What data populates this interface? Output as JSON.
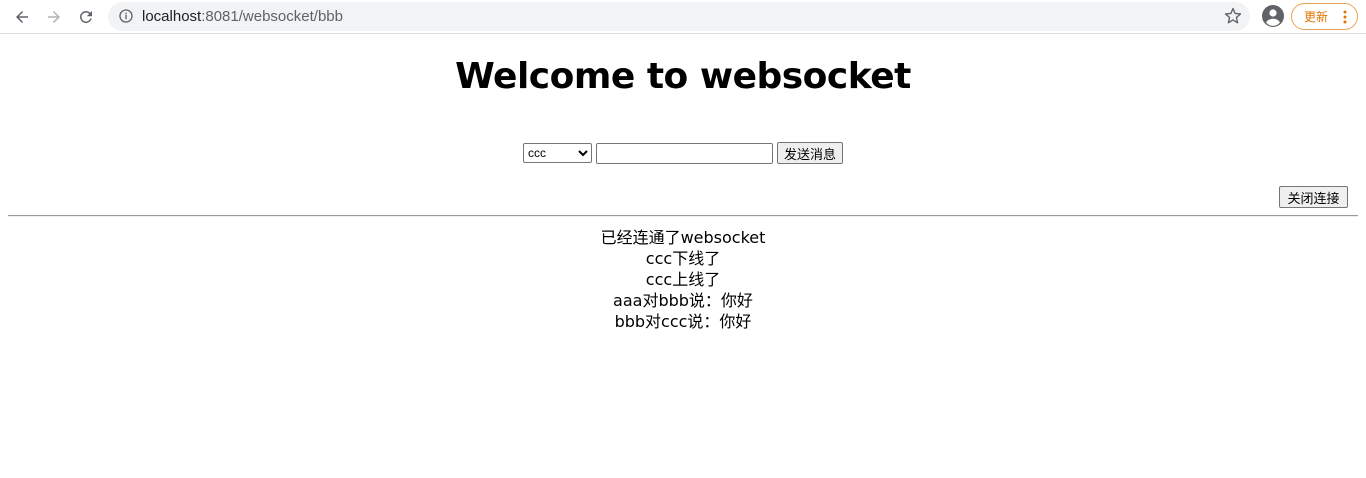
{
  "browser": {
    "url_host": "localhost",
    "url_path": ":8081/websocket/bbb",
    "update_label": "更新",
    "icons": {
      "back": "back-arrow-icon",
      "forward": "forward-arrow-icon",
      "reload": "reload-icon",
      "info": "info-icon",
      "bookmark": "star-icon",
      "profile": "profile-icon",
      "menu": "more-vert-icon"
    },
    "colors": {
      "update_accent": "#e37400",
      "omnibox_bg": "#f1f3f4"
    }
  },
  "page": {
    "title": "Welcome to websocket",
    "select": {
      "selected": "ccc",
      "options": [
        "ccc"
      ]
    },
    "message_input": {
      "value": "",
      "placeholder": ""
    },
    "send_label": "发送消息",
    "close_label": "关闭连接",
    "messages": [
      "已经连通了websocket",
      "ccc下线了",
      "ccc上线了",
      "aaa对bbb说：你好",
      "bbb对ccc说：你好"
    ]
  }
}
